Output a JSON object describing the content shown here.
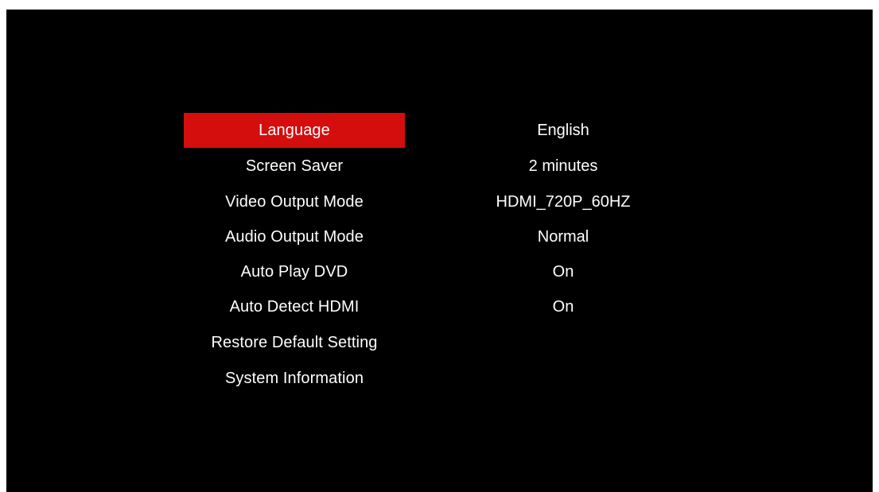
{
  "colors": {
    "background": "#000000",
    "highlight": "#d40d0d",
    "text": "#ffffff"
  },
  "menu": {
    "items": [
      {
        "label": "Language",
        "value": "English",
        "selected": true
      },
      {
        "label": "Screen Saver",
        "value": "2 minutes",
        "selected": false
      },
      {
        "label": "Video Output Mode",
        "value": "HDMI_720P_60HZ",
        "selected": false
      },
      {
        "label": "Audio Output Mode",
        "value": "Normal",
        "selected": false
      },
      {
        "label": "Auto Play DVD",
        "value": "On",
        "selected": false
      },
      {
        "label": "Auto Detect HDMI",
        "value": "On",
        "selected": false
      },
      {
        "label": "Restore Default Setting",
        "value": "",
        "selected": false
      },
      {
        "label": "System Information",
        "value": "",
        "selected": false
      }
    ]
  }
}
